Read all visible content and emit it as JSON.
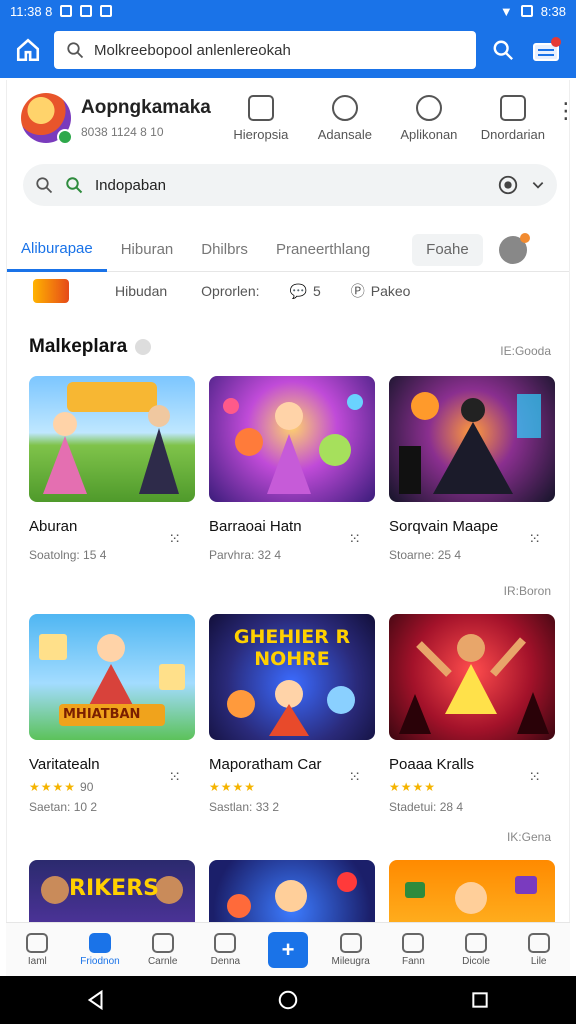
{
  "status_bar": {
    "time": "11:38 8",
    "battery": "8:38"
  },
  "app_bar": {
    "url_text": "Molkreebopool anlenlereokah"
  },
  "profile": {
    "name": "Aopngkamaka",
    "subtitle": "8038 1124 8  10"
  },
  "quick_actions": [
    {
      "label": "Hieropsia"
    },
    {
      "label": "Adansale"
    },
    {
      "label": "Aplikonan"
    },
    {
      "label": "Dnordarian"
    }
  ],
  "search": {
    "text": "Indopaban"
  },
  "tabs": [
    {
      "label": "Aliburapae"
    },
    {
      "label": "Hiburan"
    },
    {
      "label": "Dhilbrs"
    },
    {
      "label": "Praneerthlang"
    }
  ],
  "tab_pill": "Foahe",
  "filters": [
    {
      "label": "Hibudan"
    },
    {
      "label": "Oprorlen:"
    },
    {
      "label": "5"
    },
    {
      "label": "Pakeo"
    }
  ],
  "section": {
    "title": "Malkeplara",
    "link_1": "IE:Gooda",
    "link_2": "IR:Boron",
    "link_3": "IK:Gena"
  },
  "cards_row1": [
    {
      "title": "Aburan",
      "meta": "Soatolng: 15 4"
    },
    {
      "title": "Barraoai Hatn",
      "meta": "Parvhra: 32 4"
    },
    {
      "title": "Sorqvain Maape",
      "meta": "Stoarne: 25 4"
    }
  ],
  "cards_row2": [
    {
      "title": "Varitatealn",
      "rating": "90",
      "meta": "Saetan: 10 2",
      "banner": "MHIATBAN"
    },
    {
      "title": "Maporatham Car",
      "meta": "Sastlan: 33 2",
      "banner": "GHEHIER R NOHRE"
    },
    {
      "title": "Poaaa Kralls",
      "meta": "Stadetui: 28 4"
    }
  ],
  "cards_row3": [
    {
      "banner": "RIKERS"
    },
    {
      "banner": ""
    },
    {
      "banner": ""
    }
  ],
  "bottom_nav": [
    {
      "label": "Iaml"
    },
    {
      "label": "Friodnon"
    },
    {
      "label": "Carnle"
    },
    {
      "label": "Denna"
    },
    {
      "label": ""
    },
    {
      "label": "Mileugra"
    },
    {
      "label": "Fann"
    },
    {
      "label": "Dicole"
    },
    {
      "label": "Lile"
    }
  ],
  "colors": {
    "accent": "#1a73e8",
    "star": "#f5b400",
    "badge": "#f28b30"
  }
}
